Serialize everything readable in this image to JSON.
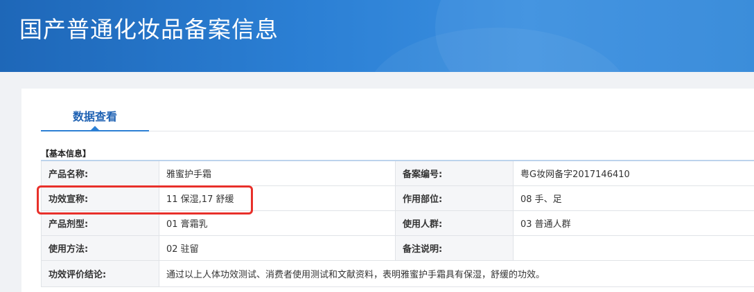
{
  "header": {
    "title": "国产普通化妆品备案信息"
  },
  "tabs": [
    {
      "label": "数据查看"
    }
  ],
  "section": {
    "title": "【基本信息】"
  },
  "info": {
    "rows": [
      {
        "label1": "产品名称:",
        "value1": "雅蜜护手霜",
        "label2": "备案编号:",
        "value2": "粤G妆网备字2017146410"
      },
      {
        "label1": "功效宣称:",
        "value1": "11 保湿,17 舒缓",
        "label2": "作用部位:",
        "value2": "08 手、足"
      },
      {
        "label1": "产品剂型:",
        "value1": "01 膏霜乳",
        "label2": "使用人群:",
        "value2": "03 普通人群"
      },
      {
        "label1": "使用方法:",
        "value1": "02 驻留",
        "label2": "备注说明:",
        "value2": ""
      }
    ],
    "conclusion": {
      "label": "功效评价结论:",
      "value": "通过以上人体功效测试、消费者使用测试和文献资料，表明雅蜜护手霜具有保湿，舒缓的功效。"
    }
  },
  "colors": {
    "header_blue": "#2b7fd4",
    "tab_blue": "#1f62b3",
    "highlight_red": "#e8302a"
  }
}
